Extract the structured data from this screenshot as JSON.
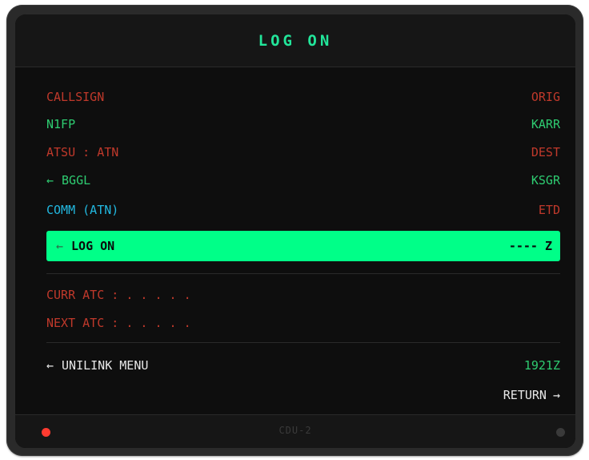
{
  "title": "LOG ON",
  "rows": {
    "callsign_label": "CALLSIGN",
    "orig_label": "ORIG",
    "callsign_value": "N1FP",
    "orig_value": "KARR",
    "atsu_label": "ATSU : ATN",
    "dest_label": "DEST",
    "atsu_value": "BGGL",
    "dest_value": "KSGR",
    "comm_label": "COMM (ATN)",
    "etd_label": "ETD"
  },
  "logon": {
    "label": "LOG ON",
    "etd_value": "---- Z"
  },
  "atc": {
    "curr": "CURR ATC : . . . . .",
    "next": "NEXT ATC : . . . . ."
  },
  "bottom": {
    "unilink_menu": "UNILINK MENU",
    "time": "1921Z",
    "return": "RETURN"
  },
  "footer": {
    "unit": "CDU-2"
  },
  "icons": {
    "left_arrow": "←",
    "right_arrow": "→"
  },
  "colors": {
    "title": "#22e59a",
    "label_red": "#c0392b",
    "value_green": "#2ecc71",
    "comm_cyan": "#22b8e0",
    "highlight": "#00ff88",
    "led_red": "#ff3b30"
  }
}
